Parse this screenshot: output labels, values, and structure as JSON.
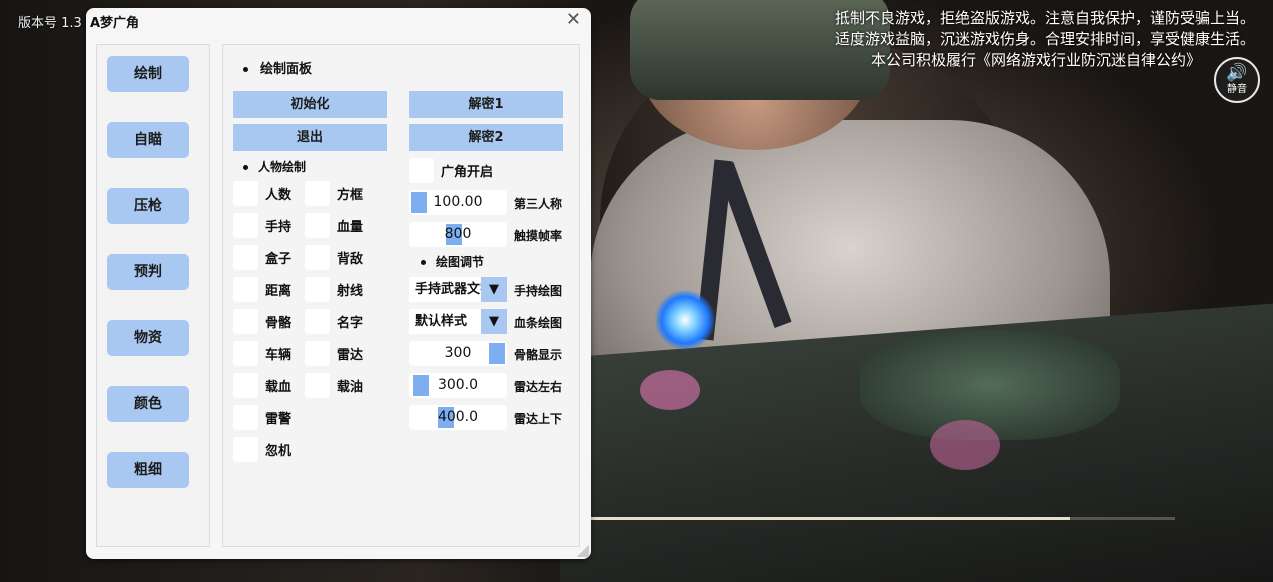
{
  "version_label": "版本号 1.3",
  "notice": [
    "抵制不良游戏，拒绝盗版游戏。注意自我保护，谨防受骗上当。",
    "适度游戏益脑，沉迷游戏伤身。合理安排时间，享受健康生活。",
    "本公司积极履行《网络游戏行业防沉迷自律公约》"
  ],
  "mute": {
    "label": "静音",
    "icon": "speaker-icon"
  },
  "video_progress": 0.82,
  "window": {
    "title": "A梦广角",
    "close_icon": "close-icon",
    "sidebar": [
      "绘制",
      "自瞄",
      "压枪",
      "预判",
      "物资",
      "颜色",
      "粗细"
    ],
    "panel": {
      "header": "绘制面板",
      "buttons": {
        "init": "初始化",
        "exit": "退出",
        "decrypt1": "解密1",
        "decrypt2": "解密2"
      },
      "person_header": "人物绘制",
      "col1": [
        "人数",
        "手持",
        "盒子",
        "距离",
        "骨骼",
        "车辆",
        "载血",
        "雷警",
        "忽机"
      ],
      "col2": [
        "方框",
        "血量",
        "背敌",
        "射线",
        "名字",
        "雷达",
        "载油"
      ],
      "wide_angle": "广角开启",
      "sliders": [
        {
          "value": "100.00",
          "label": "第三人称",
          "fill": 0.02
        },
        {
          "value": "800",
          "label": "触摸帧率",
          "fill": 0.45
        },
        {
          "value": "300",
          "label": "骨骼显示",
          "fill": 0.98
        },
        {
          "value": "300.0",
          "label": "雷达左右",
          "fill": 0.05
        },
        {
          "value": "400.0",
          "label": "雷达上下",
          "fill": 0.35
        }
      ],
      "draw_adjust_header": "绘图调节",
      "combos": [
        {
          "value": "手持武器文字",
          "label": "手持绘图"
        },
        {
          "value": "默认样式",
          "label": "血条绘图"
        }
      ]
    }
  }
}
